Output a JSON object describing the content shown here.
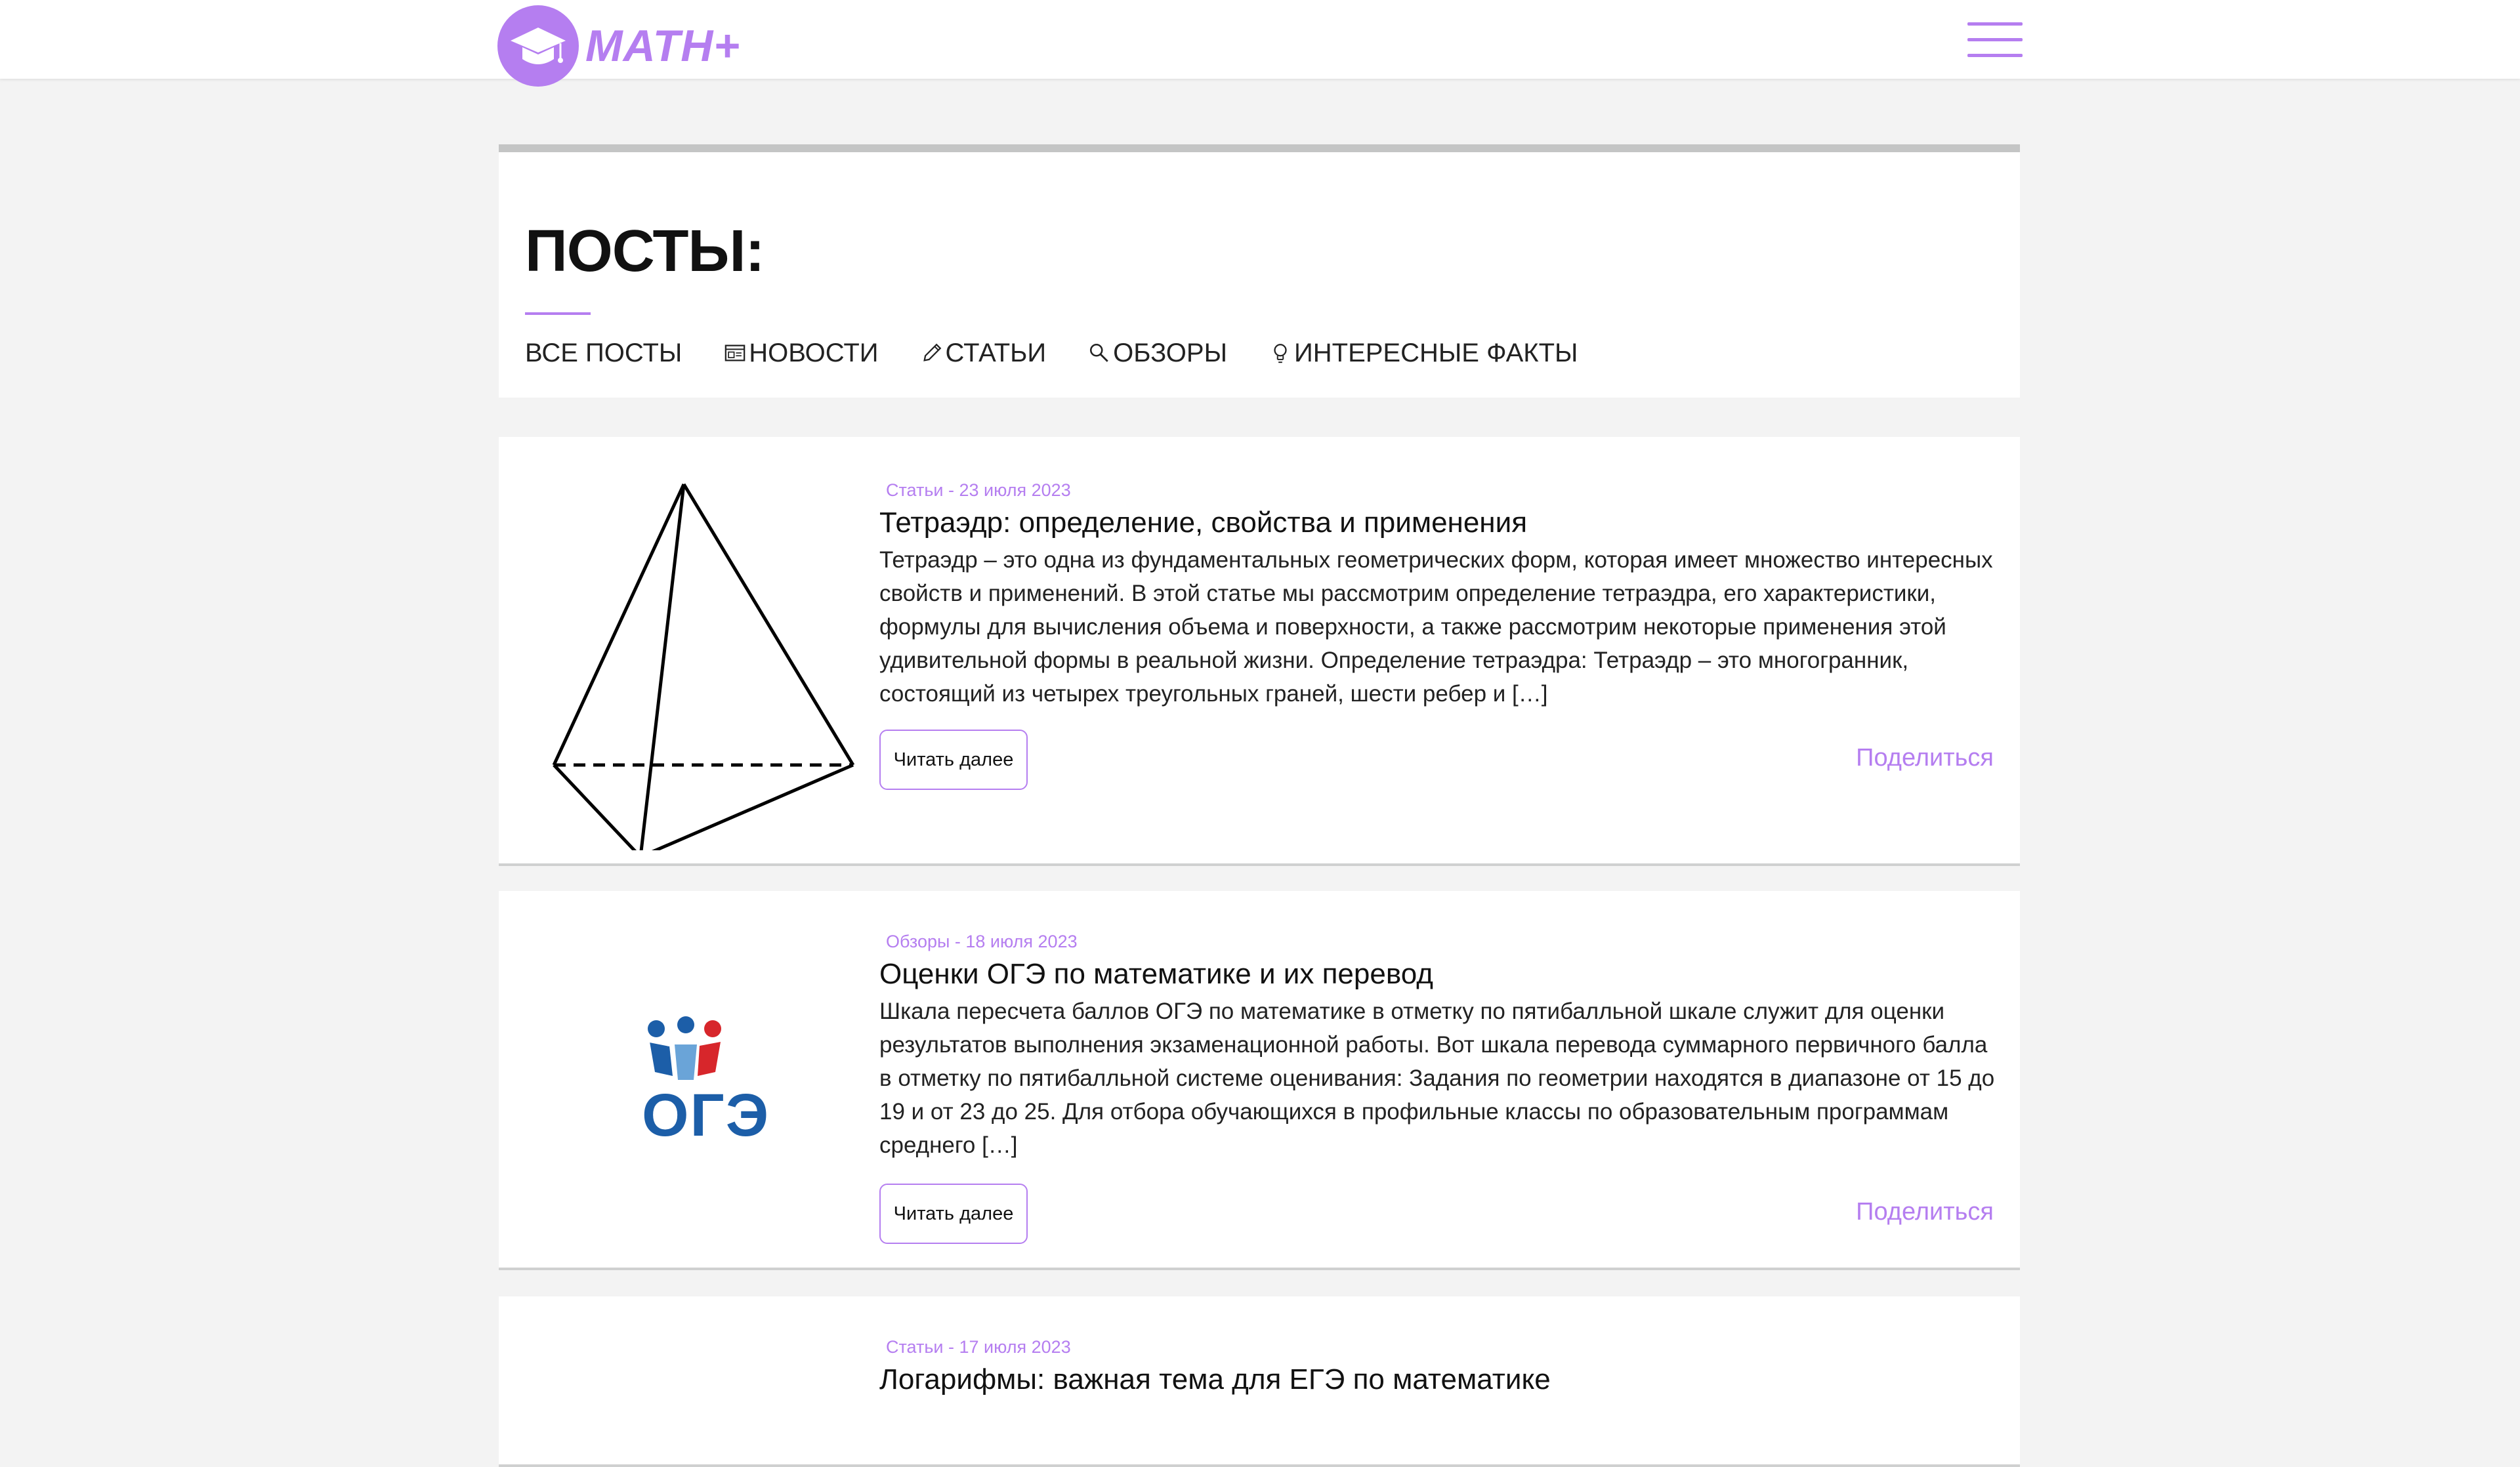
{
  "brand": {
    "name": "MATH+",
    "accent_color": "#b57ef0",
    "logo_icon": "graduation-cap-icon"
  },
  "nav": {
    "menu_icon": "hamburger-menu-icon"
  },
  "posts_section": {
    "title": "ПОСТЫ:",
    "filters": [
      {
        "label": "ВСЕ ПОСТЫ",
        "icon": null
      },
      {
        "label": "НОВОСТИ",
        "icon": "newspaper-icon"
      },
      {
        "label": "СТАТЬИ",
        "icon": "pencil-icon"
      },
      {
        "label": "ОБЗОРЫ",
        "icon": "magnifier-icon"
      },
      {
        "label": "ИНТЕРЕСНЫЕ ФАКТЫ",
        "icon": "lightbulb-icon"
      }
    ]
  },
  "posts": [
    {
      "meta": "Статьи - 23 июля 2023",
      "title": "Тетраэдр: определение, свойства и применения",
      "excerpt": "Тетраэдр – это одна из фундаментальных геометрических форм, которая имеет множество интересных свойств и применений. В этой статье мы рассмотрим определение тетраэдра, его характеристики, формулы для вычисления объема и поверхности, а также рассмотрим некоторые применения этой удивительной формы в реальной жизни. Определение тетраэдра: Тетраэдр – это многогранник, состоящий из четырех треугольных граней, шести ребер и […]",
      "read_more": "Читать далее",
      "share": "Поделиться",
      "image": "tetrahedron-drawing"
    },
    {
      "meta": "Обзоры - 18 июля 2023",
      "title": "Оценки ОГЭ по математике и их перевод",
      "excerpt": "Шкала пересчета баллов ОГЭ по математике в отметку по пятибалльной шкале служит для оценки результатов выполнения экзаменационной работы. Вот шкала перевода суммарного первичного балла в отметку по пятибалльной системе оценивания: Задания по геометрии находятся в диапазоне от 15 до 19 и от 23 до 25. Для отбора обучающихся в профильные классы по образовательным программам среднего […]",
      "read_more": "Читать далее",
      "share": "Поделиться",
      "image_label": "ОГЭ"
    },
    {
      "meta": "Статьи - 17 июля 2023",
      "title": "Логарифмы: важная тема для ЕГЭ по математике"
    }
  ]
}
